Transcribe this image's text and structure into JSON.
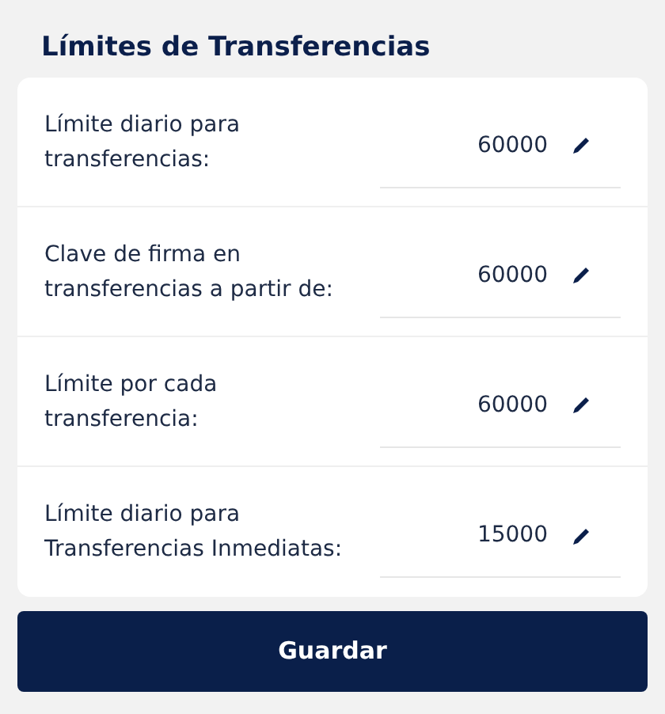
{
  "title": "Límites de Transferencias",
  "limits": [
    {
      "label": "Límite diario para\ntransferencias:",
      "value": "60000"
    },
    {
      "label": "Clave de firma en\ntransferencias a partir de:",
      "value": "60000"
    },
    {
      "label": "Límite por cada\ntransferencia:",
      "value": "60000"
    },
    {
      "label": "Límite diario para\nTransferencias Inmediatas:",
      "value": "15000"
    }
  ],
  "save_button": "Guardar"
}
